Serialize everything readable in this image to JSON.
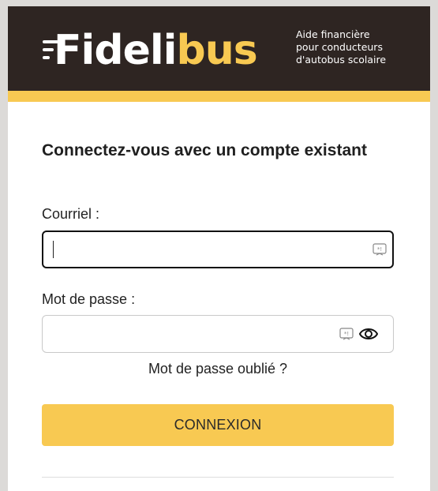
{
  "brand": {
    "logo_part1": "Fideli",
    "logo_part2": "bus",
    "tagline": [
      "Aide financière",
      "pour conducteurs",
      "d'autobus scolaire"
    ],
    "colors": {
      "header": "#2e2522",
      "accent": "#f8c952",
      "text_on_dark": "#ffffff"
    }
  },
  "form": {
    "title": "Connectez-vous avec un compte existant",
    "email_label": "Courriel :",
    "email_value": "",
    "password_label": "Mot de passe :",
    "password_value": "",
    "forgot_link": "Mot de passe oublié ?",
    "submit_label": "CONNEXION"
  },
  "icons": {
    "keyboard": "keyboard-icon",
    "eye": "eye-icon"
  }
}
